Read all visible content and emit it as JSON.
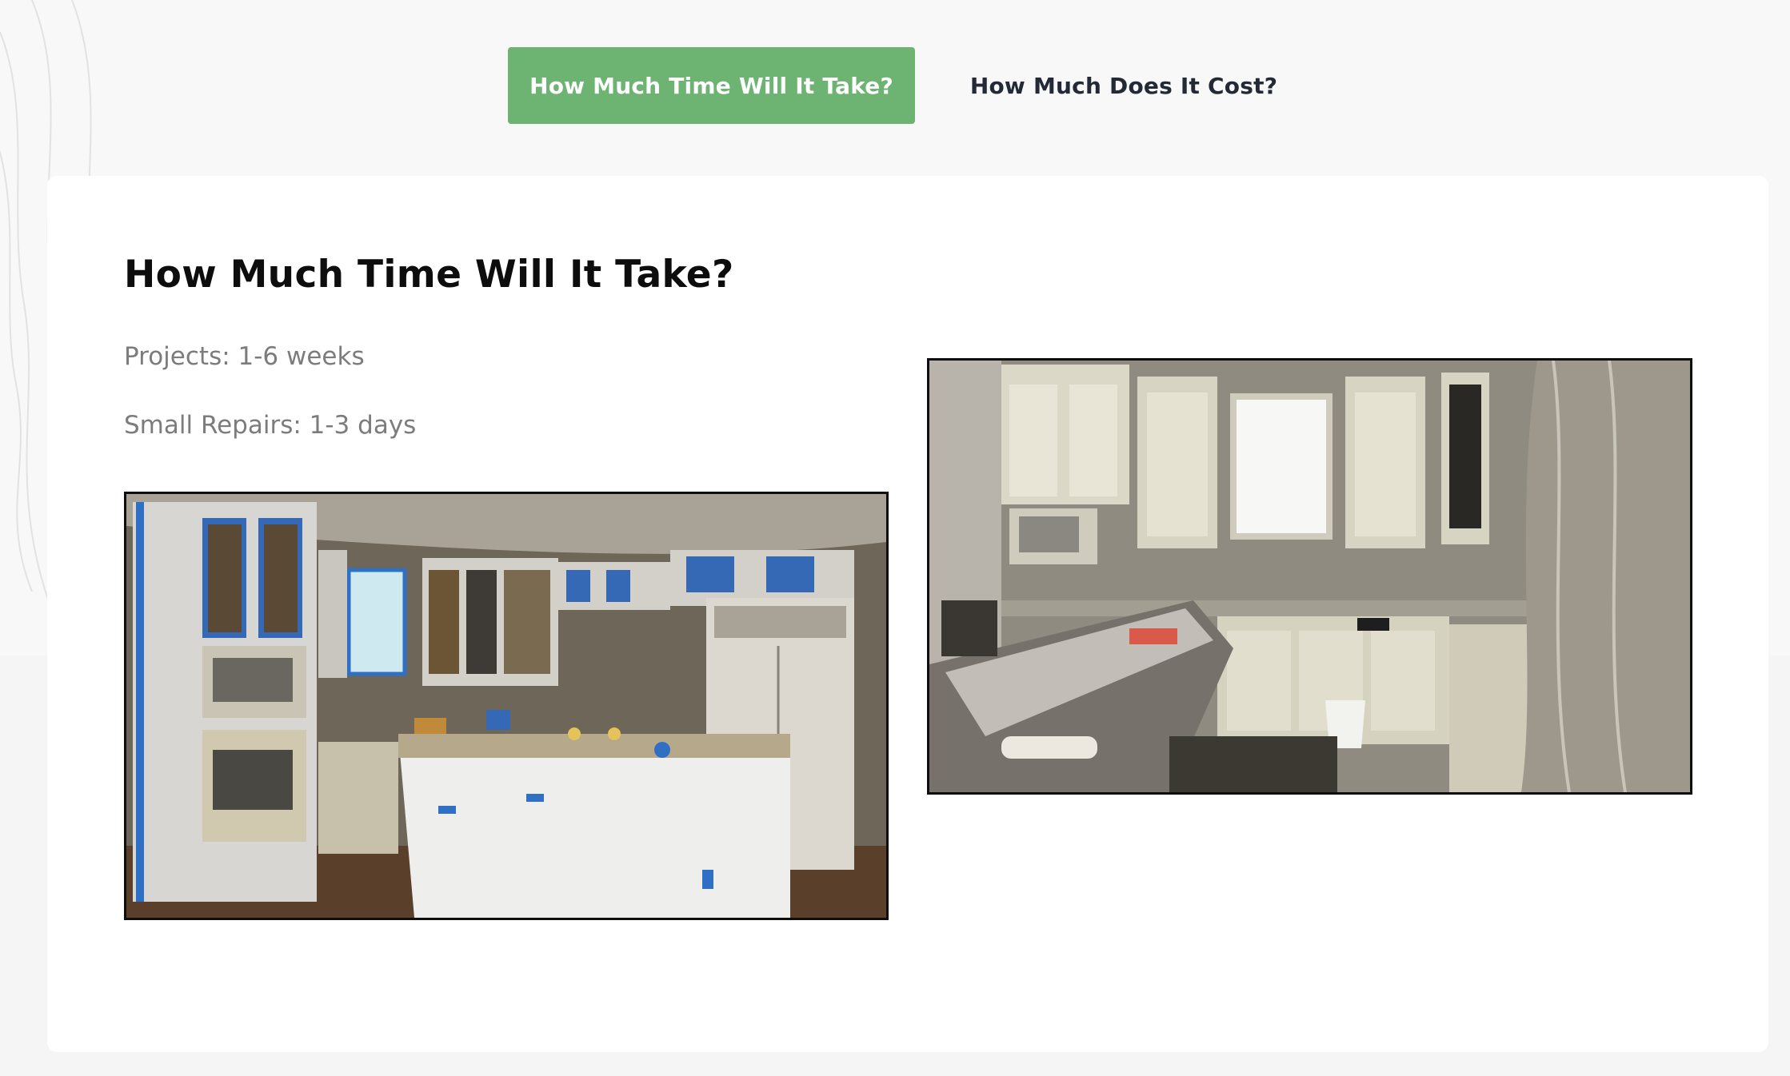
{
  "tabs": {
    "active_label": "How Much Time Will It Take?",
    "inactive_label": "How Much Does It Cost?"
  },
  "panel": {
    "title": "How Much Time Will It Take?",
    "projects_text": "Projects: 1-6 weeks",
    "repairs_text": "Small Repairs: 1-3 days"
  },
  "colors": {
    "accent": "#6db472",
    "heading": "#0d0d0d",
    "body_text": "#7c7c7c",
    "tab_text": "#232a36"
  }
}
